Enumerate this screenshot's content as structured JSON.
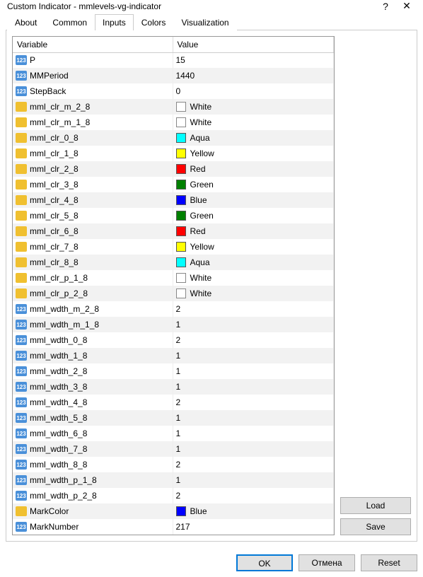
{
  "title": "Custom Indicator - mmlevels-vg-indicator",
  "help_symbol": "?",
  "close_symbol": "✕",
  "tabs": [
    {
      "label": "About"
    },
    {
      "label": "Common"
    },
    {
      "label": "Inputs"
    },
    {
      "label": "Colors"
    },
    {
      "label": "Visualization"
    }
  ],
  "active_tab": 2,
  "columns": {
    "variable": "Variable",
    "value": "Value"
  },
  "colors": {
    "White": "#ffffff",
    "Aqua": "#00ffff",
    "Yellow": "#ffff00",
    "Red": "#ff0000",
    "Green": "#008000",
    "Blue": "#0000ff"
  },
  "rows": [
    {
      "type": "int",
      "name": "P",
      "value": "15"
    },
    {
      "type": "int",
      "name": "MMPeriod",
      "value": "1440"
    },
    {
      "type": "int",
      "name": "StepBack",
      "value": "0"
    },
    {
      "type": "clr",
      "name": "mml_clr_m_2_8",
      "color": "White",
      "box": true
    },
    {
      "type": "clr",
      "name": "mml_clr_m_1_8",
      "color": "White",
      "box": true
    },
    {
      "type": "clr",
      "name": "mml_clr_0_8",
      "color": "Aqua"
    },
    {
      "type": "clr",
      "name": "mml_clr_1_8",
      "color": "Yellow"
    },
    {
      "type": "clr",
      "name": "mml_clr_2_8",
      "color": "Red"
    },
    {
      "type": "clr",
      "name": "mml_clr_3_8",
      "color": "Green"
    },
    {
      "type": "clr",
      "name": "mml_clr_4_8",
      "color": "Blue"
    },
    {
      "type": "clr",
      "name": "mml_clr_5_8",
      "color": "Green"
    },
    {
      "type": "clr",
      "name": "mml_clr_6_8",
      "color": "Red"
    },
    {
      "type": "clr",
      "name": "mml_clr_7_8",
      "color": "Yellow"
    },
    {
      "type": "clr",
      "name": "mml_clr_8_8",
      "color": "Aqua"
    },
    {
      "type": "clr",
      "name": "mml_clr_p_1_8",
      "color": "White",
      "box": true
    },
    {
      "type": "clr",
      "name": "mml_clr_p_2_8",
      "color": "White",
      "box": true
    },
    {
      "type": "int",
      "name": "mml_wdth_m_2_8",
      "value": "2"
    },
    {
      "type": "int",
      "name": "mml_wdth_m_1_8",
      "value": "1"
    },
    {
      "type": "int",
      "name": "mml_wdth_0_8",
      "value": "2"
    },
    {
      "type": "int",
      "name": "mml_wdth_1_8",
      "value": "1"
    },
    {
      "type": "int",
      "name": "mml_wdth_2_8",
      "value": "1"
    },
    {
      "type": "int",
      "name": "mml_wdth_3_8",
      "value": "1"
    },
    {
      "type": "int",
      "name": "mml_wdth_4_8",
      "value": "2"
    },
    {
      "type": "int",
      "name": "mml_wdth_5_8",
      "value": "1"
    },
    {
      "type": "int",
      "name": "mml_wdth_6_8",
      "value": "1"
    },
    {
      "type": "int",
      "name": "mml_wdth_7_8",
      "value": "1"
    },
    {
      "type": "int",
      "name": "mml_wdth_8_8",
      "value": "2"
    },
    {
      "type": "int",
      "name": "mml_wdth_p_1_8",
      "value": "1"
    },
    {
      "type": "int",
      "name": "mml_wdth_p_2_8",
      "value": "2"
    },
    {
      "type": "clr",
      "name": "MarkColor",
      "color": "Blue"
    },
    {
      "type": "int",
      "name": "MarkNumber",
      "value": "217"
    }
  ],
  "side_buttons": {
    "load": "Load",
    "save": "Save"
  },
  "footer_buttons": {
    "ok": "OK",
    "cancel": "Отмена",
    "reset": "Reset"
  }
}
